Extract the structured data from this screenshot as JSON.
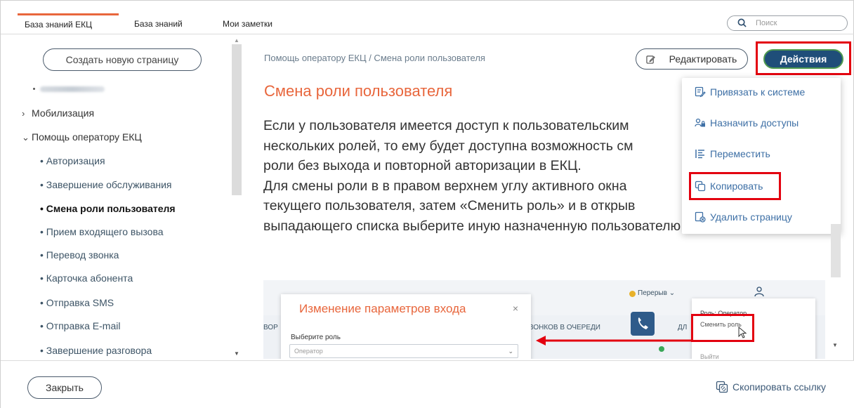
{
  "tabs": [
    {
      "label": "База знаний ЕКЦ",
      "active": true
    },
    {
      "label": "База знаний",
      "active": false
    },
    {
      "label": "Мои заметки",
      "active": false
    }
  ],
  "search": {
    "placeholder": "Поиск"
  },
  "sidebar": {
    "create_label": "Создать новую страницу",
    "items": [
      {
        "label": "Мобилизация",
        "chevron": "›"
      },
      {
        "label": "Помощь оператору ЕКЦ",
        "chevron": "⌄"
      },
      {
        "label": "• Авторизация"
      },
      {
        "label": "• Завершение обслуживания"
      },
      {
        "label": "• Смена роли пользователя"
      },
      {
        "label": "• Прием входящего вызова"
      },
      {
        "label": "• Перевод звонка"
      },
      {
        "label": "• Карточка абонента"
      },
      {
        "label": "• Отправка SMS"
      },
      {
        "label": "• Отправка E-mail"
      },
      {
        "label": "• Завершение разговора"
      }
    ]
  },
  "breadcrumb": "Помощь оператору ЕКЦ / Смена роли пользователя",
  "toolbar": {
    "edit_label": "Редактировать",
    "actions_label": "Действия"
  },
  "page": {
    "title": "Смена роли пользователя",
    "lines": [
      "Если у пользователя имеется доступ к пользовательским",
      "нескольких ролей, то ему будет доступна возможность см",
      "роли без выхода и повторной авторизации в ЕКЦ.",
      "Для смены роли в  в правом верхнем углу активного окна",
      "текущего пользователя, затем «Сменить роль» и в открыв",
      "выпадающего списка выберите иную назначенную пользователю роль."
    ]
  },
  "actions_menu": {
    "items": [
      {
        "label": "Привязать к системе",
        "icon": "link-system-icon"
      },
      {
        "label": "Назначить доступы",
        "icon": "assign-access-icon"
      },
      {
        "label": "Переместить",
        "icon": "move-icon"
      },
      {
        "label": "Копировать",
        "icon": "copy-icon"
      },
      {
        "label": "Удалить страницу",
        "icon": "delete-page-icon"
      }
    ]
  },
  "screenshot": {
    "modal_title": "Изменение параметров входа",
    "modal_close": "×",
    "select_label": "Выберите роль",
    "select_value": "Оператор",
    "bg_left": "ВОР",
    "bg_calls": "ЗВОНКОВ В ОЧЕРЕДИ",
    "bg_right": "ДЛ",
    "pause_label": "Перерыв ⌄",
    "menu_role": "Роль: Оператор",
    "menu_change": "Сменить роль",
    "menu_exit": "Выйти"
  },
  "footer": {
    "close_label": "Закрыть",
    "copy_link_label": "Скопировать ссылку"
  },
  "colors": {
    "accent": "#e8663c",
    "primary": "#1f4e79",
    "highlight": "#e3000f",
    "link": "#3d6fa5"
  }
}
